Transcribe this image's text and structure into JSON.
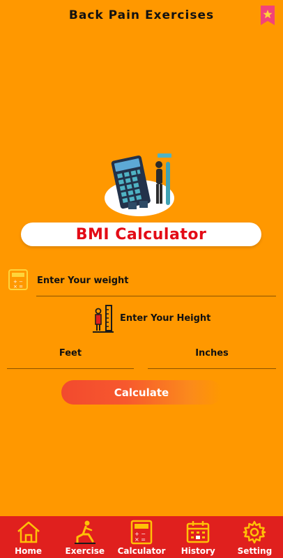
{
  "header": {
    "title": "Back Pain Exercises",
    "bookmark_icon": "star-bookmark-icon"
  },
  "card": {
    "title": "BMI Calculator"
  },
  "form": {
    "weight_label": "Enter Your weight",
    "height_label": "Enter Your Height",
    "feet_label": "Feet",
    "inches_label": "Inches",
    "calculate_label": "Calculate"
  },
  "nav": {
    "items": [
      {
        "label": "Home",
        "icon": "home-icon"
      },
      {
        "label": "Exercise",
        "icon": "exercise-icon"
      },
      {
        "label": "Calculator",
        "icon": "calculator-icon"
      },
      {
        "label": "History",
        "icon": "calendar-icon"
      },
      {
        "label": "Setting",
        "icon": "gear-icon"
      }
    ]
  },
  "colors": {
    "background": "#FF9800",
    "accent": "#E30B16",
    "nav": "#E0201E",
    "nav_icon": "#FFC107"
  }
}
